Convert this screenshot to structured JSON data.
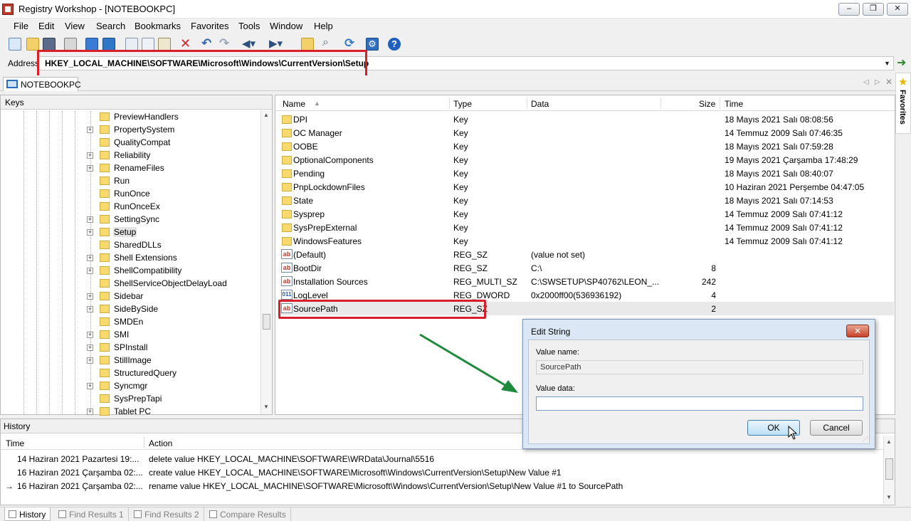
{
  "window": {
    "title": "Registry Workshop - [NOTEBOOKPC]",
    "minimize": "–",
    "maximize": "❐",
    "close": "✕"
  },
  "menu": [
    "File",
    "Edit",
    "View",
    "Search",
    "Bookmarks",
    "Favorites",
    "Tools",
    "Window",
    "Help"
  ],
  "address": {
    "label": "Address",
    "value": "HKEY_LOCAL_MACHINE\\SOFTWARE\\Microsoft\\Windows\\CurrentVersion\\Setup"
  },
  "doc_tab": {
    "label": "NOTEBOOKPC"
  },
  "favorites": {
    "label": "Favorites"
  },
  "keys": {
    "header": "Keys",
    "items": [
      {
        "label": "PreviewHandlers",
        "expandable": false
      },
      {
        "label": "PropertySystem",
        "expandable": true
      },
      {
        "label": "QualityCompat",
        "expandable": false
      },
      {
        "label": "Reliability",
        "expandable": true
      },
      {
        "label": "RenameFiles",
        "expandable": true
      },
      {
        "label": "Run",
        "expandable": false
      },
      {
        "label": "RunOnce",
        "expandable": false
      },
      {
        "label": "RunOnceEx",
        "expandable": false
      },
      {
        "label": "SettingSync",
        "expandable": true
      },
      {
        "label": "Setup",
        "expandable": true,
        "selected": true
      },
      {
        "label": "SharedDLLs",
        "expandable": false
      },
      {
        "label": "Shell Extensions",
        "expandable": true
      },
      {
        "label": "ShellCompatibility",
        "expandable": true
      },
      {
        "label": "ShellServiceObjectDelayLoad",
        "expandable": false
      },
      {
        "label": "Sidebar",
        "expandable": true
      },
      {
        "label": "SideBySide",
        "expandable": true
      },
      {
        "label": "SMDEn",
        "expandable": false
      },
      {
        "label": "SMI",
        "expandable": true
      },
      {
        "label": "SPInstall",
        "expandable": true
      },
      {
        "label": "StillImage",
        "expandable": true
      },
      {
        "label": "StructuredQuery",
        "expandable": false
      },
      {
        "label": "Syncmgr",
        "expandable": true
      },
      {
        "label": "SysPrepTapi",
        "expandable": false
      },
      {
        "label": "Tablet PC",
        "expandable": true
      }
    ]
  },
  "values": {
    "columns": {
      "name": "Name",
      "type": "Type",
      "data": "Data",
      "size": "Size",
      "time": "Time"
    },
    "rows": [
      {
        "icon": "folder",
        "name": "DPI",
        "type": "Key",
        "data": "",
        "size": "",
        "time": "18 Mayıs 2021 Salı 08:08:56"
      },
      {
        "icon": "folder",
        "name": "OC Manager",
        "type": "Key",
        "data": "",
        "size": "",
        "time": "14 Temmuz 2009 Salı 07:46:35"
      },
      {
        "icon": "folder",
        "name": "OOBE",
        "type": "Key",
        "data": "",
        "size": "",
        "time": "18 Mayıs 2021 Salı 07:59:28"
      },
      {
        "icon": "folder",
        "name": "OptionalComponents",
        "type": "Key",
        "data": "",
        "size": "",
        "time": "19 Mayıs 2021 Çarşamba 17:48:29"
      },
      {
        "icon": "folder",
        "name": "Pending",
        "type": "Key",
        "data": "",
        "size": "",
        "time": "18 Mayıs 2021 Salı 08:40:07"
      },
      {
        "icon": "folder",
        "name": "PnpLockdownFiles",
        "type": "Key",
        "data": "",
        "size": "",
        "time": "10 Haziran 2021 Perşembe 04:47:05"
      },
      {
        "icon": "folder",
        "name": "State",
        "type": "Key",
        "data": "",
        "size": "",
        "time": "18 Mayıs 2021 Salı 07:14:53"
      },
      {
        "icon": "folder",
        "name": "Sysprep",
        "type": "Key",
        "data": "",
        "size": "",
        "time": "14 Temmuz 2009 Salı 07:41:12"
      },
      {
        "icon": "folder",
        "name": "SysPrepExternal",
        "type": "Key",
        "data": "",
        "size": "",
        "time": "14 Temmuz 2009 Salı 07:41:12"
      },
      {
        "icon": "folder",
        "name": "WindowsFeatures",
        "type": "Key",
        "data": "",
        "size": "",
        "time": "14 Temmuz 2009 Salı 07:41:12"
      },
      {
        "icon": "string",
        "name": "(Default)",
        "type": "REG_SZ",
        "data": "(value not set)",
        "size": "",
        "time": ""
      },
      {
        "icon": "string",
        "name": "BootDir",
        "type": "REG_SZ",
        "data": "C:\\",
        "size": "8",
        "time": ""
      },
      {
        "icon": "string",
        "name": "Installation Sources",
        "type": "REG_MULTI_SZ",
        "data": "C:\\SWSETUP\\SP40762\\LEON_...",
        "size": "242",
        "time": ""
      },
      {
        "icon": "binary",
        "name": "LogLevel",
        "type": "REG_DWORD",
        "data": "0x2000ff00(536936192)",
        "size": "4",
        "time": ""
      },
      {
        "icon": "string",
        "name": "SourcePath",
        "type": "REG_SZ",
        "data": "",
        "size": "2",
        "time": "",
        "selected": true
      }
    ]
  },
  "history": {
    "title": "History",
    "columns": {
      "time": "Time",
      "action": "Action"
    },
    "rows": [
      {
        "marker": "",
        "time": "14 Haziran 2021 Pazartesi 19:...",
        "action": "delete value HKEY_LOCAL_MACHINE\\SOFTWARE\\WRData\\Journal\\5516"
      },
      {
        "marker": "",
        "time": "16 Haziran 2021 Çarşamba 02:...",
        "action": "create value HKEY_LOCAL_MACHINE\\SOFTWARE\\Microsoft\\Windows\\CurrentVersion\\Setup\\New Value #1"
      },
      {
        "marker": "→",
        "time": "16 Haziran 2021 Çarşamba 02:...",
        "action": "rename value HKEY_LOCAL_MACHINE\\SOFTWARE\\Microsoft\\Windows\\CurrentVersion\\Setup\\New Value #1 to SourcePath"
      }
    ]
  },
  "bottom_tabs": [
    "History",
    "Find Results 1",
    "Find Results 2",
    "Compare Results"
  ],
  "dialog": {
    "title": "Edit String",
    "close": "✕",
    "value_name_label": "Value name:",
    "value_name": "SourcePath",
    "value_data_label": "Value data:",
    "value_data": "",
    "ok": "OK",
    "cancel": "Cancel"
  },
  "colors": {
    "highlight": "#d9202a",
    "arrow": "#1e8a3c",
    "selection": "#e9e9e9"
  }
}
